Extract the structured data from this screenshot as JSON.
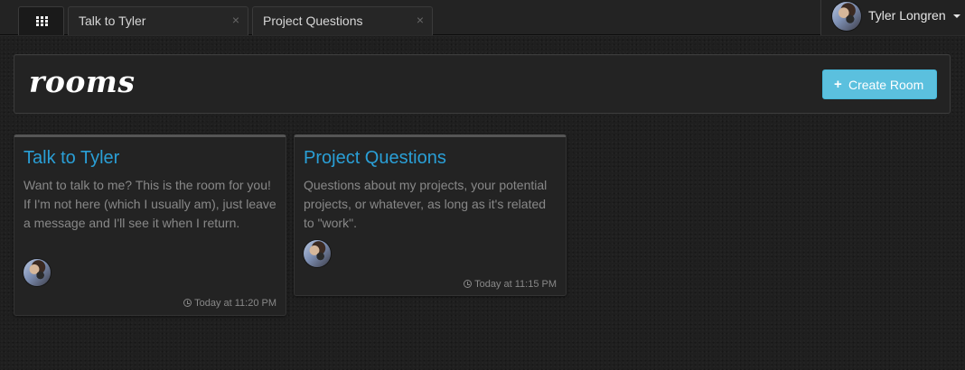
{
  "tabs": [
    {
      "label": "Talk to Tyler",
      "close": "×"
    },
    {
      "label": "Project Questions",
      "close": "×"
    }
  ],
  "user": {
    "name": "Tyler Longren"
  },
  "header": {
    "title": "rooms",
    "create_button": {
      "icon": "+",
      "label": "Create Room"
    }
  },
  "rooms": [
    {
      "title": "Talk to Tyler",
      "description": "Want to talk to me? This is the room for you! If I'm not here (which I usually am), just leave a message and I'll see it when I return.",
      "timestamp": "Today at 11:20 PM"
    },
    {
      "title": "Project Questions",
      "description": "Questions about my projects, your potential projects, or whatever, as long as it's related to \"work\".",
      "timestamp": "Today at 11:15 PM"
    }
  ],
  "colors": {
    "accent": "#2a9fd6",
    "button": "#5bc0de",
    "background": "#1f1f1f"
  },
  "icons": [
    "grid-icon",
    "close-icon",
    "avatar",
    "chevron-down-icon",
    "plus-icon",
    "clock-icon"
  ]
}
